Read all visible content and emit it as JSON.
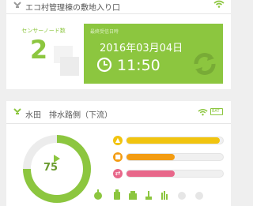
{
  "card1": {
    "title": "エコ村管理棟の敷地入り口",
    "sensor_label": "センサーノード数",
    "sensor_count": "2",
    "tile_label": "最終受信日時",
    "date": "2016年03月04日",
    "time": "11:50"
  },
  "card2": {
    "title": "水田　排水路側（下流）",
    "battery_label": "BAT",
    "gauge_value": "75",
    "gauge_fraction": 0.75,
    "bars": [
      {
        "name": "temperature",
        "color": "#f1c40f",
        "fraction": 0.97,
        "icon": "thermometer-icon"
      },
      {
        "name": "level",
        "color": "#f39c12",
        "fraction": 0.5,
        "icon": "water-level-icon"
      },
      {
        "name": "flow",
        "color": "#e8678a",
        "fraction": 0.5,
        "icon": "flow-icon"
      }
    ]
  },
  "colors": {
    "accent": "#8cc63f",
    "accent_dark": "#6a9a2f",
    "background": "#efefef"
  }
}
